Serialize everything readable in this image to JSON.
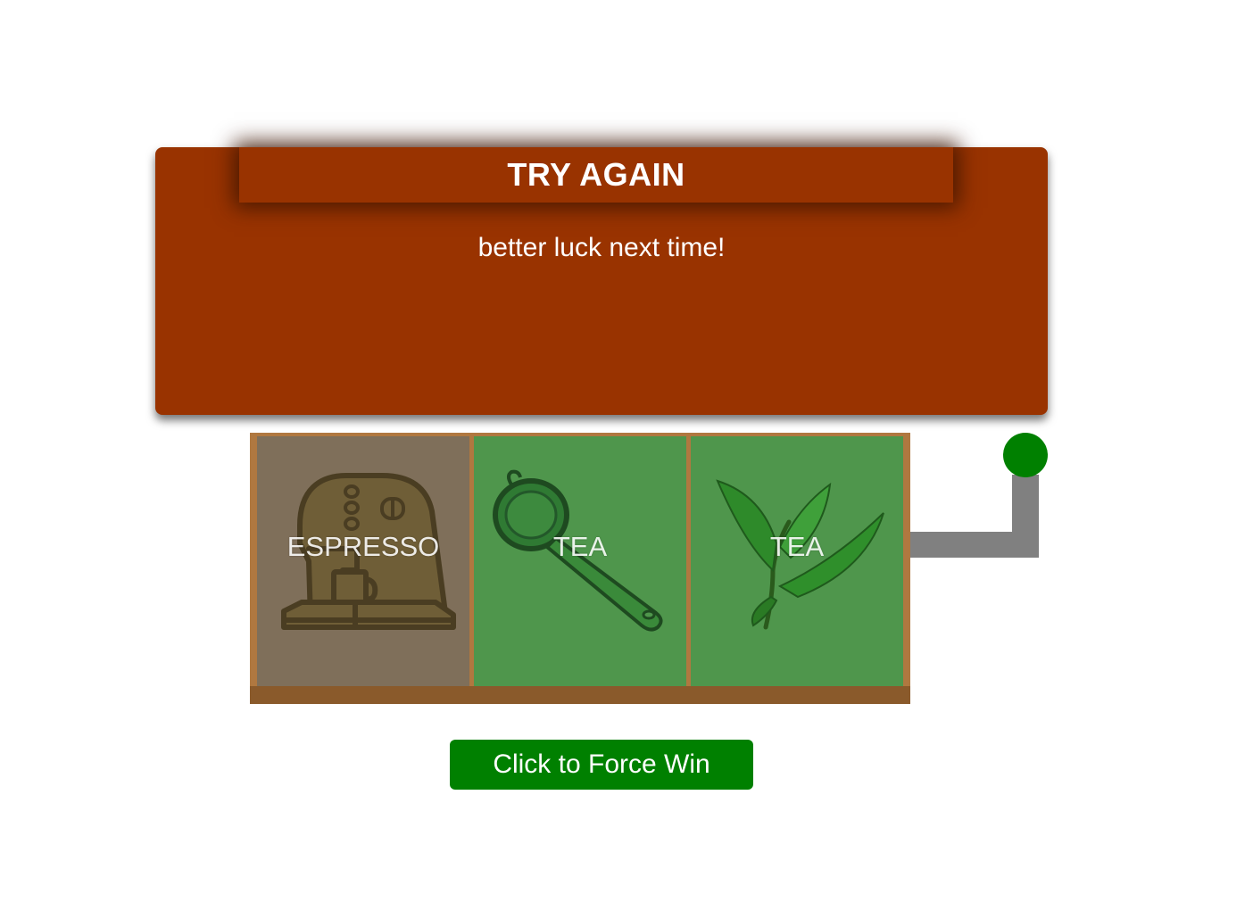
{
  "result": {
    "title": "TRY AGAIN",
    "message": "better luck next time!"
  },
  "reels": [
    {
      "label": "ESPRESSO",
      "icon": "espresso-machine-icon",
      "background": "#7f6f5a"
    },
    {
      "label": "TEA",
      "icon": "tea-strainer-icon",
      "background": "#4f964c"
    },
    {
      "label": "TEA",
      "icon": "tea-leaves-icon",
      "background": "#4f964c"
    }
  ],
  "force_win": {
    "label": "Click to Force Win"
  },
  "colors": {
    "panel": "#993300",
    "lever_knob": "#008000",
    "lever_arm": "#808080",
    "button": "#008000",
    "machine_frame": "#b07840",
    "machine_base": "#8a5a2b"
  }
}
